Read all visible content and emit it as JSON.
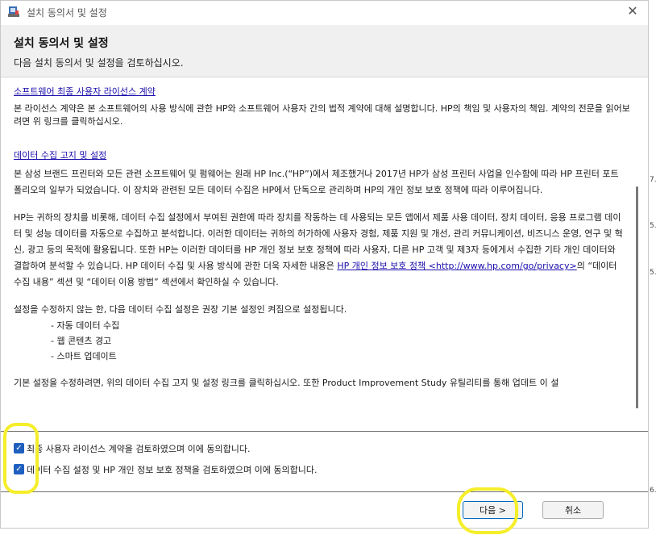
{
  "window": {
    "title": "설치 동의서 및 설정",
    "close_glyph": "✕"
  },
  "header": {
    "title": "설치 동의서 및 설정",
    "subtitle": "다음 설치 동의서 및 설정을 검토하십시오."
  },
  "license": {
    "link": "소프트웨어 최종 사용자 라이선스 계약",
    "text": "본 라이선스 계약은 본 소프트웨어의 사용 방식에 관한 HP와 소프트웨어 사용자 간의 법적 계약에 대해 설명합니다. HP의 책임 및 사용자의 책임. 계약의 전문을 읽어보려면 위 링크를 클릭하십시오."
  },
  "data_collection": {
    "link": "데이터 수집 고지 및 설정",
    "para1": "본 삼성 브랜드 프린터와 모든 관련 소프트웨어 및 펌웨어는 원래 HP Inc.(“HP”)에서 제조했거나 2017년 HP가 삼성 프린터 사업을 인수함에 따라 HP 프린터 포트폴리오의 일부가 되었습니다. 이 장치와 관련된 모든 데이터 수집은 HP에서 단독으로 관리하며 HP의 개인 정보 보호 정책에 따라 이루어집니다.",
    "para2_before": "HP는 귀하의 장치를 비롯해, 데이터 수집 설정에서 부여된 권한에 따라 장치를 작동하는 데 사용되는 모든 앱에서 제품 사용 데이터, 장치 데이터, 응용 프로그램 데이터 및 성능 데이터를 자동으로 수집하고 분석합니다. 이러한 데이터는 귀하의 허가하에 사용자 경험, 제품 지원 및 개선, 관리 커뮤니케이션, 비즈니스 운영, 연구 및 혁신, 광고 등의 목적에 활용됩니다. 또한 HP는 이러한 데이터를 HP 개인 정보 보호 정책에 따라 사용자, 다른 HP 고객 및 제3자 등에게서 수집한 기타 개인 데이터와 결합하여 분석할 수 있습니다. HP 데이터 수집 및 사용 방식에 관한 더욱 자세한 내용은 ",
    "para2_link": "HP 개인 정보 보호 정책 <http://www.hp.com/go/privacy>",
    "para2_after": "의 “데이터 수집 내용” 섹션 및 “데이터 이용 방법” 섹션에서 확인하실 수 있습니다.",
    "para3": "설정을 수정하지 않는 한, 다음 데이터 수집 설정은 권장 기본 설정인 켜짐으로 설정됩니다.",
    "bullets": [
      "- 자동 데이터 수집",
      "- 웹 콘텐츠 경고",
      "- 스마트 업데이트"
    ],
    "para4": "기본 설정을 수정하려면, 위의 데이터 수집 고지 및 설정 링크를 클릭하십시오. 또한 Product Improvement Study 유틸리티를 통해 업데트 이 설"
  },
  "checkboxes": [
    {
      "label": "최종 사용자 라이선스 계약을 검토하였으며 이에 동의합니다.",
      "checked": true
    },
    {
      "label": "데이터 수집 설정 및 HP 개인 정보 보호 정책을 검토하였으며 이에 동의합니다.",
      "checked": true
    }
  ],
  "check_glyph": "✓",
  "buttons": {
    "next": "다음 >",
    "cancel": "취소"
  },
  "colors": {
    "accent": "#1f5fbf",
    "link": "#1a0dab",
    "highlight": "#f5ee2a",
    "header_bg": "#f0f0f0"
  },
  "side_fragments": [
    "7.",
    "5.",
    "5.",
    "6."
  ]
}
